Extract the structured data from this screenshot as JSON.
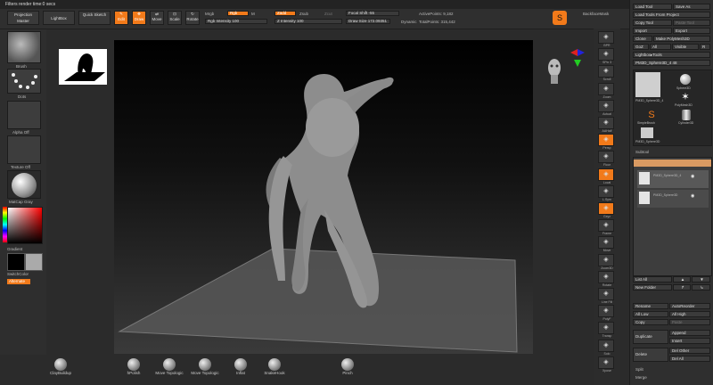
{
  "status_message": "Filters render time:0 secs",
  "toolbar": {
    "projection_master": "Projection Master",
    "lightbox": "LightBox",
    "quick_sketch": "Quick Sketch",
    "edit": "Edit",
    "draw": "Draw",
    "move": "Move",
    "scale": "Scale",
    "rotate": "Rotate",
    "mrgb": "Mrgb",
    "rgb": "Rgb",
    "m": "M",
    "zadd": "Zadd",
    "zsub": "Zsub",
    "zcut": "Zcut",
    "rgb_intensity": "Rgb Intensity 100",
    "z_intensity": "Z Intensity 100",
    "focal_shift": "Focal Shift -55",
    "draw_size": "Draw Size 172.09351",
    "dynamic": "Dynamic",
    "active_points": "ActivePoints: 9,182",
    "total_points": "TotalPoints: 315,442",
    "backface_mask": "BackfaceMask"
  },
  "left_shelf": {
    "brush_label": "Brush",
    "dots_label": "Dots",
    "alpha_label": "Alpha Off",
    "texture_label": "Texture Off",
    "material_label": "MatCap Gray",
    "gradient_label": "Gradient",
    "switch_color": "SwitchColor",
    "alternate": "Alternate"
  },
  "right_shelf": [
    {
      "name": "bpr",
      "label": "BPR"
    },
    {
      "name": "spix",
      "label": "SPix 3"
    },
    {
      "name": "scroll",
      "label": "Scroll"
    },
    {
      "name": "zoom",
      "label": "Zoom"
    },
    {
      "name": "actual",
      "label": "Actual"
    },
    {
      "name": "aahalf",
      "label": "AAHalf"
    },
    {
      "name": "persp",
      "label": "Persp"
    },
    {
      "name": "floor",
      "label": "Floor"
    },
    {
      "name": "local",
      "label": "Local"
    },
    {
      "name": "lsym",
      "label": "L.Sym"
    },
    {
      "name": "xyz",
      "label": "Gxyz"
    },
    {
      "name": "frame",
      "label": "Frame"
    },
    {
      "name": "move",
      "label": "Move"
    },
    {
      "name": "zoom3d",
      "label": "Zoom3D"
    },
    {
      "name": "rotate",
      "label": "Rotate"
    },
    {
      "name": "linefill",
      "label": "Line Fill"
    },
    {
      "name": "polyf",
      "label": "PolyF"
    },
    {
      "name": "transp",
      "label": "Transp"
    },
    {
      "name": "solo",
      "label": "Solo"
    },
    {
      "name": "xpose",
      "label": "Xpose"
    }
  ],
  "tool_panel": {
    "load_tool": "Load Tool",
    "save_as": "Save As",
    "load_from_project": "Load Tools From Project",
    "copy_tool": "Copy Tool",
    "paste_tool": "Paste Tool",
    "import": "Import",
    "export": "Export",
    "clone": "Clone",
    "make_polymesh": "Make PolyMesh3D",
    "goz": "GoZ",
    "all": "All",
    "visible": "Visible",
    "r": "R",
    "lightbox_tools": "Lightbox▸Tools",
    "current_tool": "PM3D_Sphere3D_4",
    "current_tool_count": "48",
    "tools": [
      {
        "name": "PM3D_Sphere3D_4"
      },
      {
        "name": "Sphere3D"
      },
      {
        "name": "PolyMesh3D"
      },
      {
        "name": "SimpleBrush"
      },
      {
        "name": "Cylinder3D"
      },
      {
        "name": "PM3D_Sphere3D"
      }
    ],
    "subtool_title": "Subtool",
    "subtools": [
      {
        "name": "PM3D_Sphere3D_4"
      },
      {
        "name": "PM3D_Sphere3D"
      }
    ],
    "list_all": "List All",
    "new_folder": "New Folder",
    "rename": "Rename",
    "auto_reorder": "AutoReorder",
    "all_low": "All Low",
    "all_high": "All High",
    "copy": "Copy",
    "paste": "Paste",
    "duplicate": "Duplicate",
    "append": "Append",
    "insert": "Insert",
    "delete": "Delete",
    "del_other": "Del Other",
    "del_all": "Del All",
    "split": "Split",
    "merge": "Merge"
  },
  "bottom_brushes": [
    {
      "label": "ClayBuildup"
    },
    {
      "label": "hPolish"
    },
    {
      "label": "Move Topologic"
    },
    {
      "label": "Move Topologic"
    },
    {
      "label": "Inflat"
    },
    {
      "label": "SnakeHook"
    },
    {
      "label": "Pinch"
    }
  ],
  "colors": {
    "accent": "#f27a1a",
    "panel": "#2f2f2f",
    "canvas_bg": "#000000",
    "model": "#8d8d8d"
  }
}
